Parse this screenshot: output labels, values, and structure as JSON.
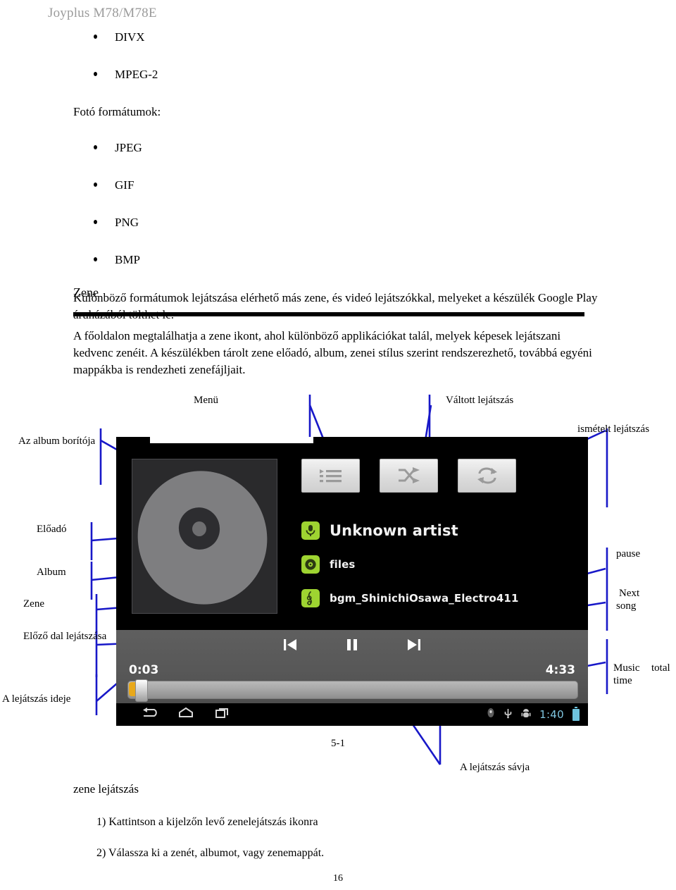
{
  "header": {
    "title": "Joyplus M78/M78E"
  },
  "video_formats": [
    {
      "label": "DIVX"
    },
    {
      "label": "MPEG-2"
    }
  ],
  "photo_heading": "Fotó formátumok:",
  "photo_formats": [
    {
      "label": "JPEG"
    },
    {
      "label": "GIF"
    },
    {
      "label": "PNG"
    },
    {
      "label": "BMP"
    }
  ],
  "formats_note": "Különböző formátumok lejátszása elérhető más zene, és videó lejátszókkal, melyeket a készülék Google Play áruházából tölthet le.",
  "music_section": {
    "heading": "Zene",
    "paragraph": "A főoldalon megtalálhatja a zene ikont, ahol különböző applikációkat talál, melyek képesek lejátszani kedvenc zenéit. A készülékben tárolt zene előadó, album, zenei stílus szerint rendszerezhető, továbbá egyéni mappákba is rendezheti zenefájljait."
  },
  "annotations": {
    "menu": "Menü",
    "shuffle": "Váltott lejátszás",
    "repeat": "ismételt lejátszás",
    "album_cover": "Az album borítója",
    "artist": "Előadó",
    "album": "Album",
    "song": "Zene",
    "prev_song": "Előző dal lejátszása",
    "elapsed_time": "A lejátszás ideje",
    "pause": "pause",
    "next_song": "Next\nsong",
    "next_song_l1": "Next",
    "next_song_l2": "song",
    "music_time_l1": "Music",
    "music_time_l2": "time",
    "total": "total",
    "seek_bar": "A lejátszás sávja"
  },
  "device_screen": {
    "buttons": [
      {
        "name": "playlist-button",
        "icon": "playlist-icon"
      },
      {
        "name": "shuffle-button",
        "icon": "shuffle-icon"
      },
      {
        "name": "repeat-button",
        "icon": "repeat-icon"
      }
    ],
    "meta": [
      {
        "icon": "microphone-icon",
        "text": "Unknown artist",
        "size": "big"
      },
      {
        "icon": "disc-icon",
        "text": "files",
        "size": "sm"
      },
      {
        "icon": "treble-clef-icon",
        "text": "bgm_ShinichiOsawa_Electro411",
        "size": "sm"
      }
    ],
    "transport": [
      {
        "name": "previous-button",
        "icon": "skip-previous-icon"
      },
      {
        "name": "pause-button",
        "icon": "pause-icon"
      },
      {
        "name": "next-button",
        "icon": "skip-next-icon"
      }
    ],
    "elapsed": "0:03",
    "duration": "4:33",
    "statusbar": {
      "clock": "1:40"
    },
    "colors": {
      "accent_green": "#9ed431",
      "seek_fill": "#e8a81a",
      "clock_blue": "#7fc6e0",
      "leader_blue": "#1818c8"
    }
  },
  "figure_caption": "5-1",
  "steps": {
    "title": "zene lejátszás",
    "one": "1) Kattintson a kijelzőn levő zenelejátszás ikonra",
    "two": "2) Válassza ki a zenét, albumot, vagy zenemappát."
  },
  "page_number": "16"
}
